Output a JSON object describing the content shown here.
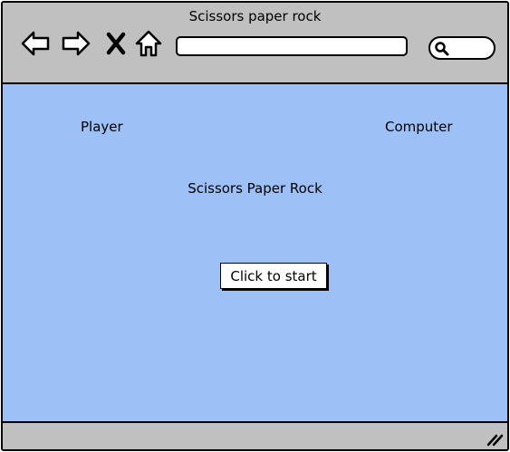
{
  "window": {
    "title": "Scissors paper rock"
  },
  "toolbar": {
    "back_icon": "back-arrow-icon",
    "forward_icon": "forward-arrow-icon",
    "stop_icon": "close-x-icon",
    "home_icon": "home-icon",
    "address_value": "",
    "search_icon": "search-icon"
  },
  "game": {
    "player_label": "Player",
    "computer_label": "Computer",
    "title": "Scissors Paper Rock",
    "start_button": "Click to start"
  },
  "colors": {
    "chrome": "#c0c0c0",
    "content_background": "#9dc0f6",
    "button_background": "#ffffff",
    "outline": "#000000"
  },
  "statusbar": {
    "resize_icon": "resize-grip-icon"
  }
}
